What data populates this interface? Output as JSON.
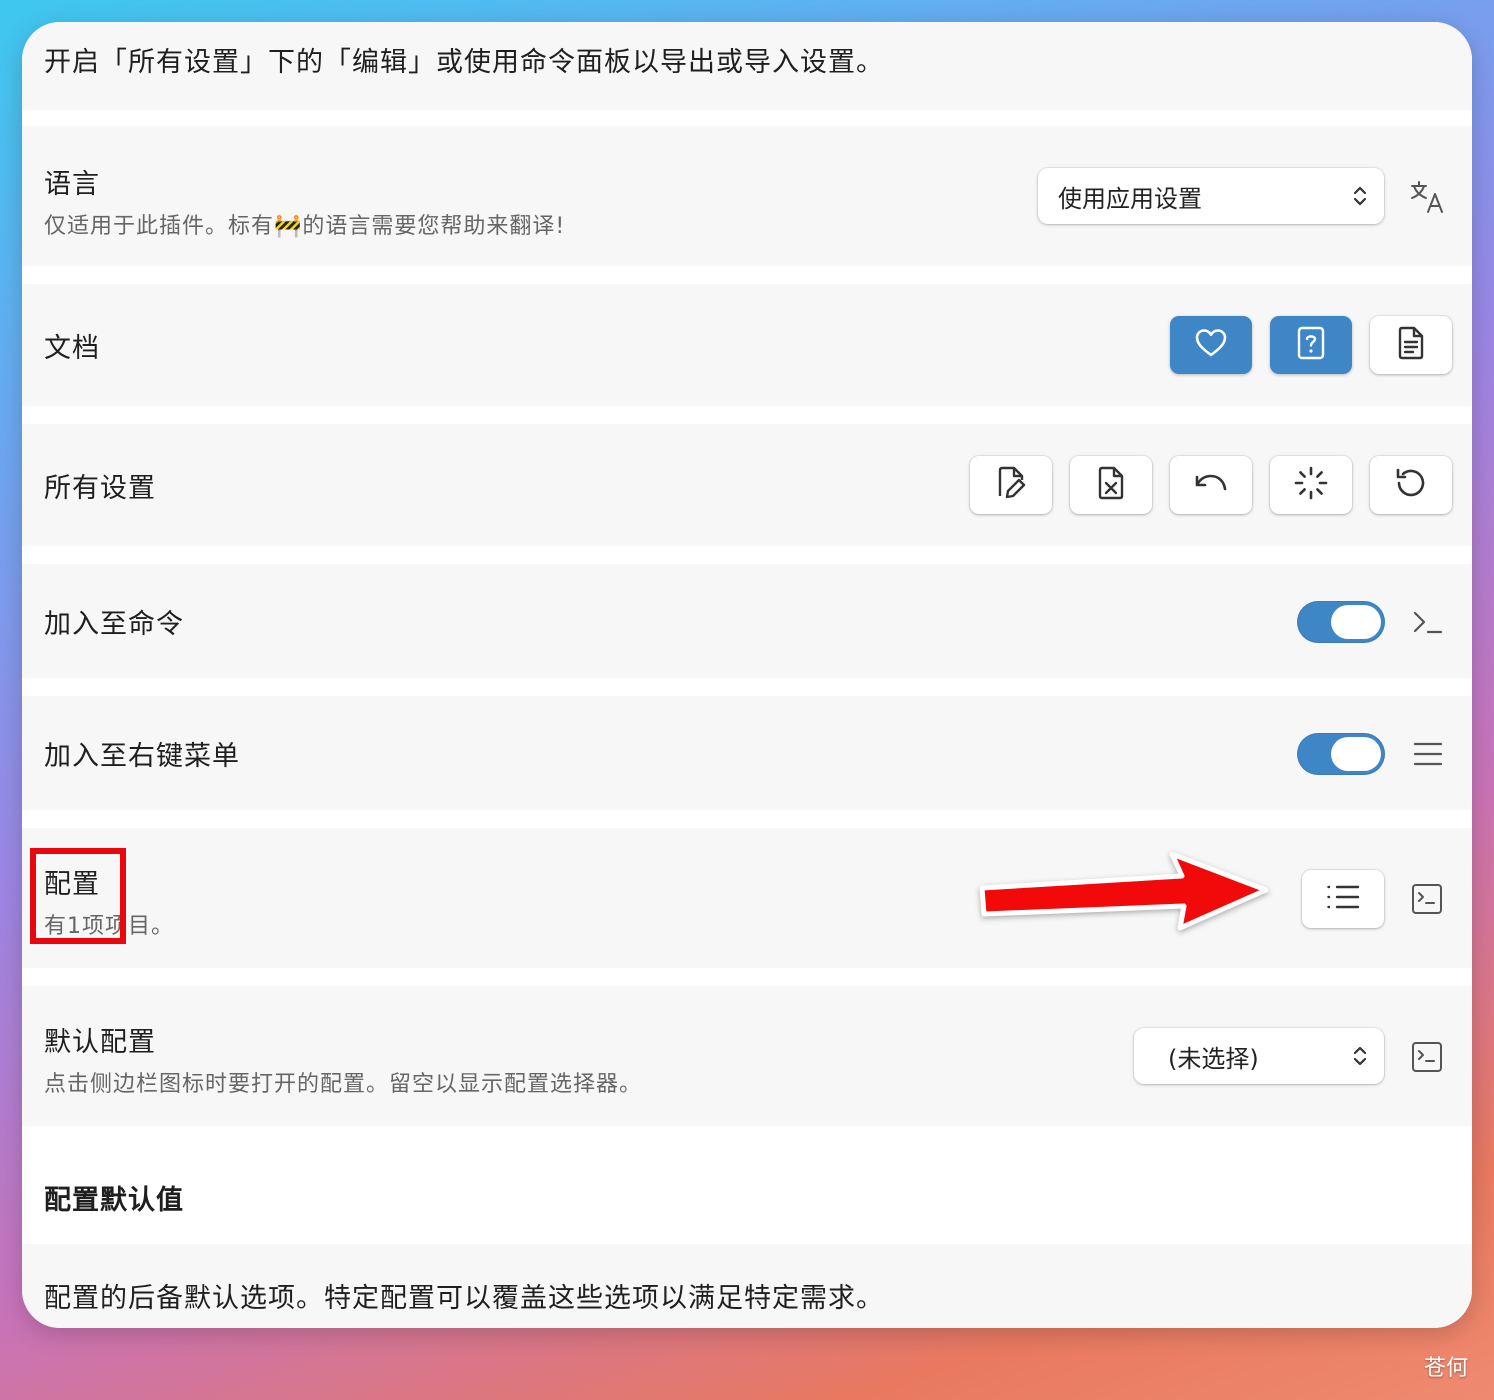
{
  "intro_text": "开启「所有设置」下的「编辑」或使用命令面板以导出或导入设置。",
  "language": {
    "title": "语言",
    "desc": "仅适用于此插件。标有🚧的语言需要您帮助来翻译!",
    "select_value": "使用应用设置",
    "icon": "translate-icon"
  },
  "docs": {
    "title": "文档",
    "buttons": [
      "heart-icon",
      "help-icon",
      "document-icon"
    ]
  },
  "all_settings": {
    "title": "所有设置",
    "buttons": [
      "edit-file-icon",
      "delete-file-icon",
      "undo-icon",
      "loader-icon",
      "reset-icon"
    ]
  },
  "add_to_commands": {
    "title": "加入至命令",
    "enabled": true,
    "icon": "terminal-prompt-icon"
  },
  "add_to_context_menu": {
    "title": "加入至右键菜单",
    "enabled": true,
    "icon": "menu-icon"
  },
  "profiles": {
    "title": "配置",
    "desc": "有1项项目。",
    "button_icon": "list-icon",
    "icon": "terminal-square-icon"
  },
  "default_profile": {
    "title": "默认配置",
    "desc": "点击侧边栏图标时要打开的配置。留空以显示配置选择器。",
    "select_value": "(未选择)",
    "icon": "terminal-square-icon"
  },
  "profile_defaults": {
    "title": "配置默认值",
    "desc": "配置的后备默认选项。特定配置可以覆盖这些选项以满足特定需求。"
  },
  "annotation": {
    "highlight_color": "#e8070d",
    "arrow_color": "#f20a0a"
  },
  "watermark": "苍何",
  "colors": {
    "accent": "#3e86c6",
    "row_bg": "#f7f7f7"
  }
}
